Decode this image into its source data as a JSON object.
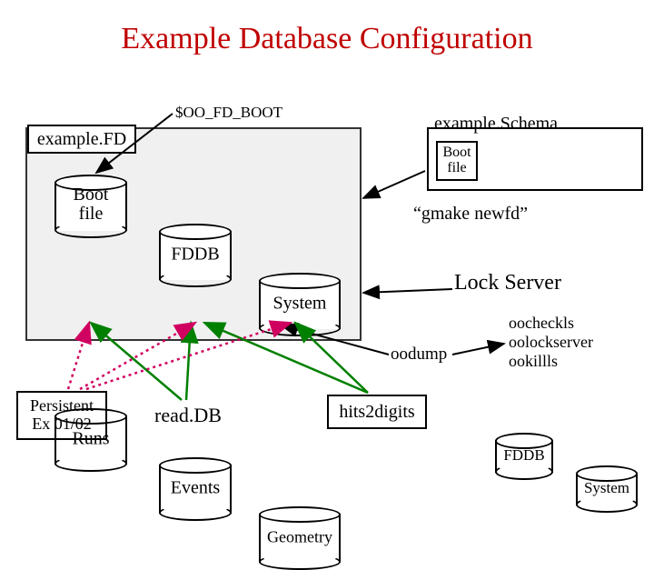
{
  "title": "Example Database Configuration",
  "env_var": "$OO_FD_BOOT",
  "left_container": {
    "label": "example.FD",
    "boot": "Boot\nfile",
    "fddb": "FDDB",
    "system": "System",
    "runs": "Runs",
    "events": "Events",
    "geometry": "Geometry"
  },
  "right_container": {
    "label": "example.Schema",
    "boot": "Boot\nfile",
    "fddb": "FDDB",
    "system": "System"
  },
  "gmake": "“gmake newfd”",
  "lock_server": "Lock Server",
  "tools": "oocheckls\noolockserver\nookillls",
  "oodump": "oodump",
  "persistent_box": "Persistent\nEx 01/02",
  "readdb": "read.DB",
  "hits": "hits2digits"
}
